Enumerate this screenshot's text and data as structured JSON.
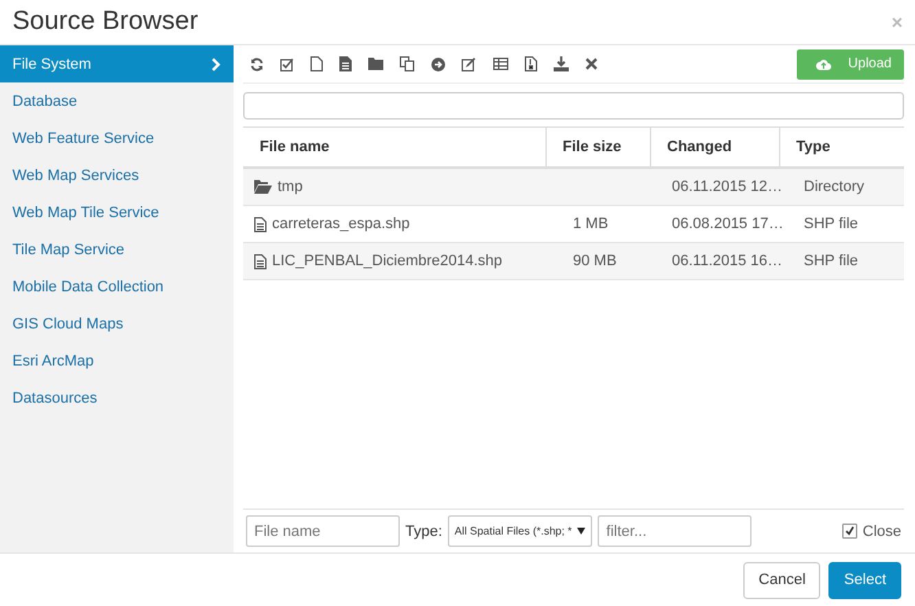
{
  "window": {
    "title": "Source Browser",
    "close": "×"
  },
  "sidebar": {
    "items": [
      {
        "label": "File System",
        "selected": true
      },
      {
        "label": "Database",
        "selected": false
      },
      {
        "label": "Web Feature Service",
        "selected": false
      },
      {
        "label": "Web Map Services",
        "selected": false
      },
      {
        "label": "Web Map Tile Service",
        "selected": false
      },
      {
        "label": "Tile Map Service",
        "selected": false
      },
      {
        "label": "Mobile Data Collection",
        "selected": false
      },
      {
        "label": "GIS Cloud Maps",
        "selected": false
      },
      {
        "label": "Esri ArcMap",
        "selected": false
      },
      {
        "label": "Datasources",
        "selected": false
      }
    ]
  },
  "toolbar": {
    "tools": [
      {
        "kind": "refresh"
      },
      {
        "kind": "check"
      },
      {
        "kind": "file"
      },
      {
        "kind": "document"
      },
      {
        "kind": "folder"
      },
      {
        "kind": "copy"
      },
      {
        "kind": "arrow"
      },
      {
        "kind": "edit"
      },
      {
        "kind": "table"
      },
      {
        "kind": "archive"
      },
      {
        "kind": "download"
      },
      {
        "kind": "delete"
      }
    ],
    "upload": "Upload"
  },
  "table": {
    "columns": [
      "File name",
      "File size",
      "Changed",
      "Type"
    ],
    "rows": [
      {
        "kind": "folder",
        "name": "tmp",
        "size": "",
        "changed": "06.11.2015 12…",
        "type": "Directory"
      },
      {
        "kind": "file",
        "name": "carreteras_espa.shp",
        "size": "1 MB",
        "changed": "06.08.2015 17…",
        "type": "SHP file"
      },
      {
        "kind": "file",
        "name": "LIC_PENBAL_Diciembre2014.shp",
        "size": "90 MB",
        "changed": "06.11.2015 16…",
        "type": "SHP file"
      }
    ]
  },
  "filter_bar": {
    "file_name": {
      "placeholder": "File name"
    },
    "type_label": "Type:",
    "type_value": "All Spatial Files (*.shp; *",
    "filter": {
      "placeholder": "filter..."
    },
    "close_label": "Close",
    "close_checked": true
  },
  "buttons": [
    {
      "kind": "default",
      "label": "Cancel"
    },
    {
      "kind": "primary",
      "label": "Select"
    }
  ]
}
